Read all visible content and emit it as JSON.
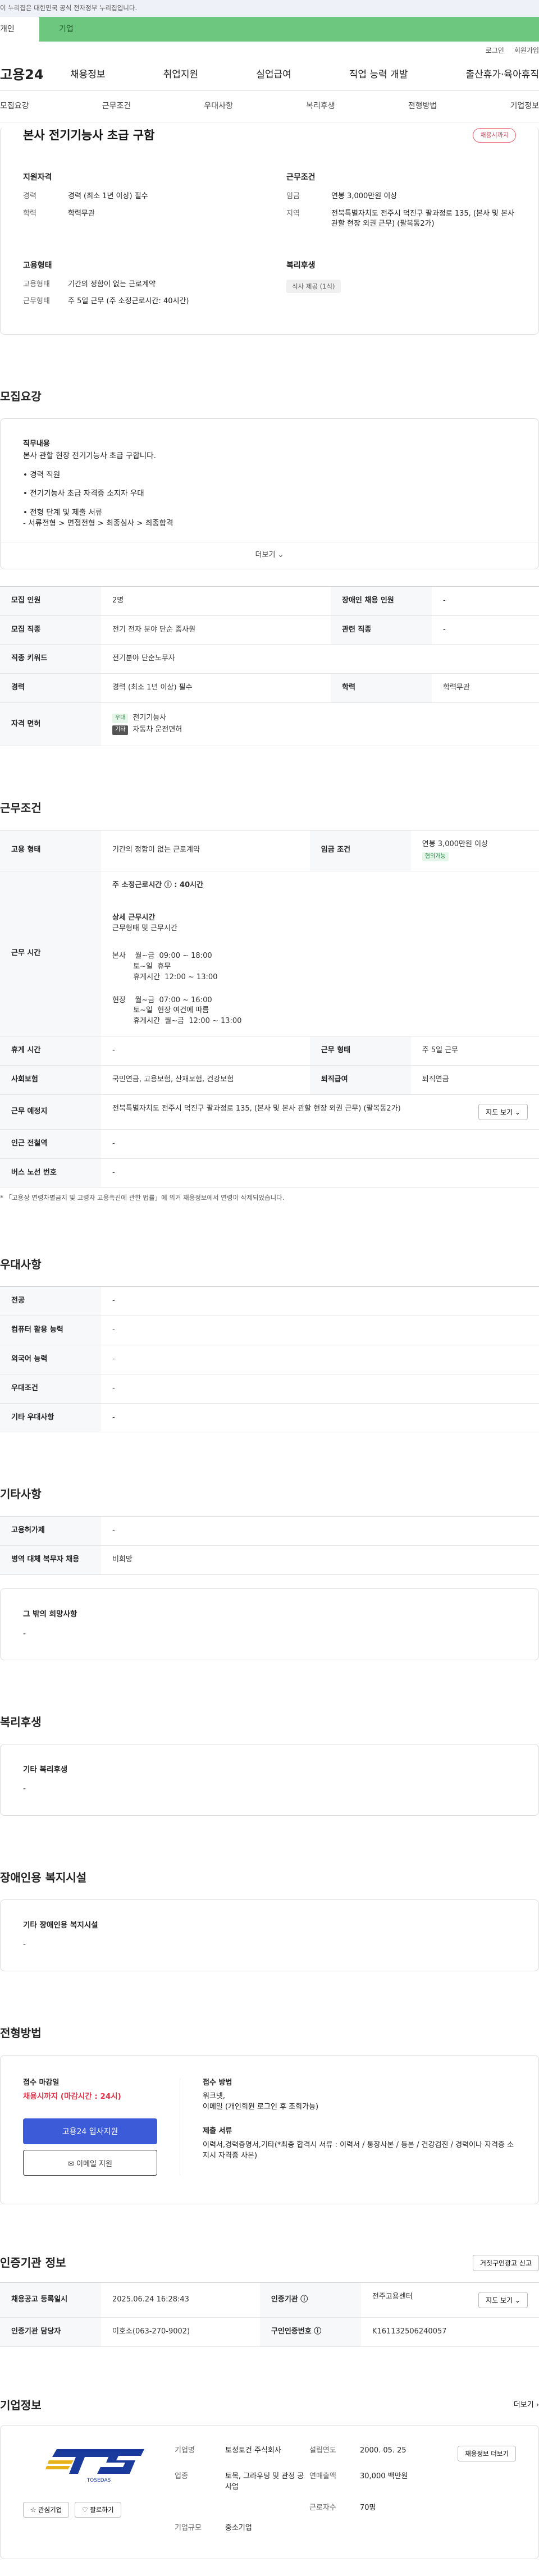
{
  "gov_bar": {
    "text": "이 누리집은 대한민국 공식 전자정부 누리집입니다."
  },
  "tabs": {
    "personal": "개인",
    "company": "기업"
  },
  "util": {
    "login": "로그인",
    "signup": "회원가입"
  },
  "gnb": {
    "logo": "고용24",
    "menu": [
      "채용정보",
      "취업지원",
      "실업급여",
      "직업 능력 개발",
      "출산휴가·육아휴직"
    ]
  },
  "snb": [
    "모집요강",
    "근무조건",
    "우대사항",
    "복리후생",
    "전형방법",
    "기업정보"
  ],
  "job": {
    "title": "본사 전기기능사 초급 구함",
    "deadline_badge": "채용시까지",
    "summary": {
      "qual_title": "지원자격",
      "career_k": "경력",
      "career_v": "경력 (최소 1년 이상) 필수",
      "edu_k": "학력",
      "edu_v": "학력무관",
      "emp_title": "고용형태",
      "emp_k": "고용형태",
      "emp_v": "기간의 정함이 없는 근로계약",
      "hours_k": "근무형태",
      "hours_v": "주 5일 근무 (주 소정근로시간: 40시간)",
      "cond_title": "근무조건",
      "wage_k": "임금",
      "wage_v": "연봉 3,000만원 이상",
      "region_k": "지역",
      "region_v": "전북특별자치도 전주시 덕진구 팔과정로 135, (본사 및 본사 관할 현장 외권 근무) (팔복동2가)",
      "welfare_title": "복리후생",
      "welfare_chip": "식사 제공 (1식)"
    }
  },
  "recruit": {
    "title": "모집요강",
    "duty_title": "직무내용",
    "duty_text": "본사 관할 현장 전기기능사 초급 구합니다.",
    "line1": "• 경력 직원",
    "line2": "• 전기기능사 초급 자격증 소지자 우대",
    "line3": "• 전형 단계 및 제출 서류\n  - 서류전형  >  면접전형  >  최종심사  >  최종합격",
    "more": "더보기 ⌄",
    "rows": {
      "headcount_k": "모집 인원",
      "headcount_v": "2명",
      "disabled_k": "장애인 채용 인원",
      "disabled_v": "-",
      "job_k": "모집 직종",
      "job_v": "전기 전자 분야 단순 종사원",
      "related_k": "관련 직종",
      "related_v": "-",
      "keyword_k": "직종 키워드",
      "keyword_v": "전기분야 단순노무자",
      "career_k": "경력",
      "career_v": "경력 (최소 1년 이상) 필수",
      "edu_k": "학력",
      "edu_v": "학력무관",
      "license_k": "자격 면허",
      "lic1_tag": "우대",
      "lic1": "전기기능사",
      "lic2_tag": "기타",
      "lic2": "자동차 운전면허"
    }
  },
  "work": {
    "title": "근무조건",
    "emp_k": "고용 형태",
    "emp_v": "기간의 정함이 없는 근로계약",
    "wage_k": "임금 조건",
    "wage_v": "연봉 3,000만원 이상",
    "wage_tag": "협의가능",
    "time_k": "근무 시간",
    "weekly": "주 소정근로시간 ⓘ : 40시간",
    "detail_title": "상세 근무시간",
    "detail_sub": "근무형태 및 근무시간",
    "detail_lines": [
      "본사    월~금  09:00 ~ 18:00",
      "         토~일  휴무",
      "         휴게시간  12:00 ~ 13:00",
      "",
      "현장    월~금  07:00 ~ 16:00",
      "         토~일  현장 여건에 따름",
      "         휴게시간  월~금  12:00 ~ 13:00"
    ],
    "rest_k": "휴게 시간",
    "rest_v": "-",
    "type_k": "근무 형태",
    "type_v": "주 5일 근무",
    "ins_k": "사회보험",
    "ins_v": "국민연금, 고용보험, 산재보험, 건강보험",
    "sev_k": "퇴직급여",
    "sev_v": "퇴직연금",
    "addr_k": "근무 예정지",
    "addr_v": "전북특별자치도 전주시 덕진구 팔과정로 135, (본사 및 본사 관할 현장 외권 근무) (팔복동2가)",
    "map_btn": "지도 보기 ⌄",
    "subway_k": "인근 전철역",
    "subway_v": "-",
    "bus_k": "버스 노선 번호",
    "bus_v": "-",
    "note": "* 「고용상 연령차별금지 및 고령자 고용촉진에 관한 법률」에 의거 채용정보에서 연령이 삭제되었습니다."
  },
  "pref": {
    "title": "우대사항",
    "major_k": "전공",
    "major_v": "-",
    "comp_k": "컴퓨터 활용 능력",
    "comp_v": "-",
    "lang_k": "외국어 능력",
    "lang_v": "-",
    "cond_k": "우대조건",
    "cond_v": "-",
    "etc_k": "기타 우대사항",
    "etc_v": "-"
  },
  "etc": {
    "title": "기타사항",
    "prog_k": "고용허가제",
    "prog_v": "-",
    "mil_k": "병역 대체 복무자 채용",
    "mil_v": "비희망",
    "hope_title": "그 밖의 희망사항",
    "hope_v": "-"
  },
  "welfare": {
    "title": "복리후생",
    "box_title": "기타 복리후생",
    "box_v": "-"
  },
  "disabled": {
    "title": "장애인용 복지시설",
    "box_title": "기타 장애인용 복지시설",
    "box_v": "-"
  },
  "apply": {
    "title": "전형방법",
    "deadline_k": "접수 마감일",
    "deadline_v": "채용시까지 (마감시간 : 24시)",
    "btn_online": "고용24 입사지원",
    "btn_email": "✉ 이메일 지원",
    "method_k": "접수 방법",
    "method_v": "워크넷,\n이메일 (개인회원 로그인 후 조회가능)",
    "docs_k": "제출 서류",
    "docs_v": "이력서,경력증명서,기타(*최종 합격시 서류 : 이력서 / 통장사본 / 등본 / 건강검진 / 경력이나 자격증 소지시 자격증 사본)"
  },
  "cert": {
    "title": "인증기관 정보",
    "report_btn": "거짓구인광고 신고",
    "date_k": "채용공고 등록일시",
    "date_v": "2025.06.24 16:28:43",
    "org_k": "인증기관 ⓘ",
    "org_v": "전주고용센터",
    "map_btn": "지도 보기 ⌄",
    "manager_k": "인증기관 담당자",
    "manager_v": "이호소(063-270-9002)",
    "no_k": "구인인증번호 ⓘ",
    "no_v": "K161132506240057"
  },
  "company": {
    "title": "기업정보",
    "more": "더보기 ›",
    "logo_text": "TOSEDAS",
    "fav_btn": "☆ 관심기업",
    "follow_btn": "♡ 팔로하기",
    "name_k": "기업명",
    "name_v": "토성토건 주식회사",
    "est_k": "설립연도",
    "est_v": "2000. 05. 25",
    "detail_btn": "채용정보 더보기",
    "ind_k": "업종",
    "ind_v": "토목, 그라우팅 및 관정 공사업",
    "sales_k": "연매출액",
    "sales_v": "30,000 백만원",
    "emp_k": "근로자수",
    "emp_v": "70명",
    "size_k": "기업규모",
    "size_v": "중소기업"
  },
  "colors": {
    "accent_green": "#6ec77f",
    "accent_blue": "#3c5bd9",
    "deadline_red": "#e0364c"
  }
}
